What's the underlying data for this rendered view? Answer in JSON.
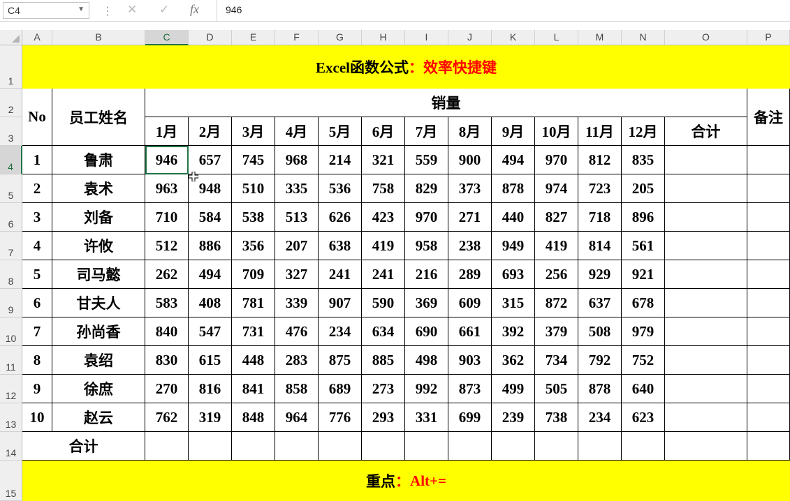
{
  "formula_bar": {
    "name_box": "C4",
    "formula": "946",
    "fx_label": "fx"
  },
  "columns": [
    "A",
    "B",
    "C",
    "D",
    "E",
    "F",
    "G",
    "H",
    "I",
    "J",
    "K",
    "L",
    "M",
    "N",
    "O",
    "P"
  ],
  "rows": [
    "1",
    "2",
    "3",
    "4",
    "5",
    "6",
    "7",
    "8",
    "9",
    "10",
    "11",
    "12",
    "13",
    "14",
    "15"
  ],
  "title": {
    "prefix": "Excel函数公式",
    "colon": "：",
    "highlight": "效率快捷键"
  },
  "header": {
    "no": "No",
    "name": "员工姓名",
    "sales": "销量",
    "months": [
      "1月",
      "2月",
      "3月",
      "4月",
      "5月",
      "6月",
      "7月",
      "8月",
      "9月",
      "10月",
      "11月",
      "12月"
    ],
    "total": "合计",
    "remark": "备注"
  },
  "employees": [
    {
      "no": "1",
      "name": "鲁肃",
      "sales": [
        "946",
        "657",
        "745",
        "968",
        "214",
        "321",
        "559",
        "900",
        "494",
        "970",
        "812",
        "835"
      ]
    },
    {
      "no": "2",
      "name": "袁术",
      "sales": [
        "963",
        "948",
        "510",
        "335",
        "536",
        "758",
        "829",
        "373",
        "878",
        "974",
        "723",
        "205"
      ]
    },
    {
      "no": "3",
      "name": "刘备",
      "sales": [
        "710",
        "584",
        "538",
        "513",
        "626",
        "423",
        "970",
        "271",
        "440",
        "827",
        "718",
        "896"
      ]
    },
    {
      "no": "4",
      "name": "许攸",
      "sales": [
        "512",
        "886",
        "356",
        "207",
        "638",
        "419",
        "958",
        "238",
        "949",
        "419",
        "814",
        "561"
      ]
    },
    {
      "no": "5",
      "name": "司马懿",
      "sales": [
        "262",
        "494",
        "709",
        "327",
        "241",
        "241",
        "216",
        "289",
        "693",
        "256",
        "929",
        "921"
      ]
    },
    {
      "no": "6",
      "name": "甘夫人",
      "sales": [
        "583",
        "408",
        "781",
        "339",
        "907",
        "590",
        "369",
        "609",
        "315",
        "872",
        "637",
        "678"
      ]
    },
    {
      "no": "7",
      "name": "孙尚香",
      "sales": [
        "840",
        "547",
        "731",
        "476",
        "234",
        "634",
        "690",
        "661",
        "392",
        "379",
        "508",
        "979"
      ]
    },
    {
      "no": "8",
      "name": "袁绍",
      "sales": [
        "830",
        "615",
        "448",
        "283",
        "875",
        "885",
        "498",
        "903",
        "362",
        "734",
        "792",
        "752"
      ]
    },
    {
      "no": "9",
      "name": "徐庶",
      "sales": [
        "270",
        "816",
        "841",
        "858",
        "689",
        "273",
        "992",
        "873",
        "499",
        "505",
        "878",
        "640"
      ]
    },
    {
      "no": "10",
      "name": "赵云",
      "sales": [
        "762",
        "319",
        "848",
        "964",
        "776",
        "293",
        "331",
        "699",
        "239",
        "738",
        "234",
        "623"
      ]
    }
  ],
  "total_row_label": "合计",
  "footer": {
    "prefix": "重点",
    "colon": "：",
    "highlight": "Alt+="
  },
  "colors": {
    "accent": "#217346",
    "highlight_fill": "#ffff00",
    "emphasis_text": "#ff0000"
  }
}
